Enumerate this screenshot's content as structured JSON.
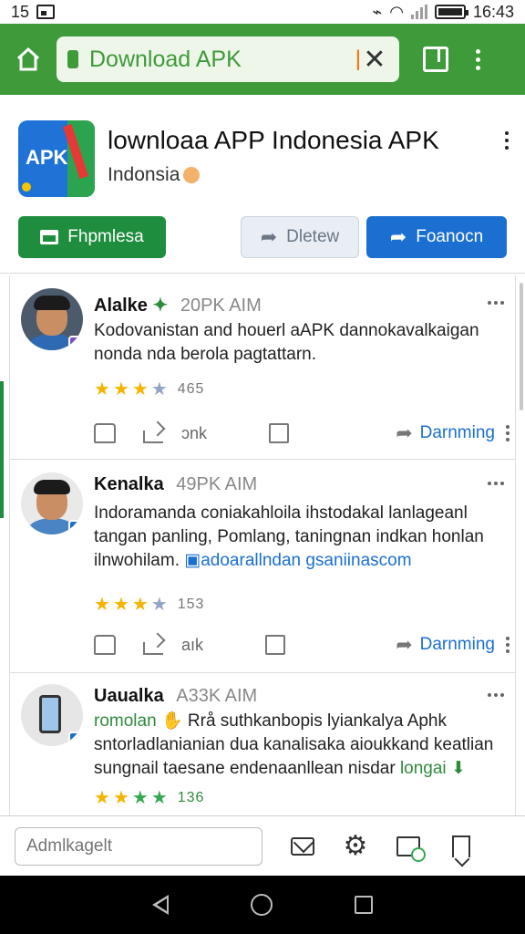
{
  "status_bar": {
    "time": "15",
    "clock": "16:43"
  },
  "browser": {
    "url_text": "Download APK",
    "clear_label": "✕"
  },
  "app": {
    "title": "lownloaa APP Indonesia APK",
    "subtitle": "Indonsia",
    "icon_text": "APK",
    "buttons": {
      "install": "Fhpmlesa",
      "detew": "Dletew",
      "foanoc": "Foanocn"
    }
  },
  "posts": [
    {
      "name": "Alalke",
      "meta": "20PK AIM",
      "lines": [
        "Kodovanistan and houerl aAPK dannokavalkaigan",
        "nonda nda berola pagtattarn."
      ],
      "stars_filled": 3,
      "stars_total": 4,
      "rating_count": "465",
      "action_text": "ɔnk",
      "action_label": "Darnming"
    },
    {
      "name": "Kenalka",
      "meta": "49PK AIM",
      "lines": [
        "Indoramanda coniakahloila ihstodakal lanlageanl",
        "tangan panling, Pomlang, taningnan indkan honlan",
        "ilnwohilam."
      ],
      "link": "adoarallndan gsaniinascom",
      "stars_filled": 3,
      "stars_total": 4,
      "rating_count": "153",
      "action_text": "aık",
      "action_label": "Darnming"
    },
    {
      "name": "Uaualka",
      "meta": "A33K AIM",
      "lead": "romolan",
      "lines": [
        "Rrå suthkanbopis lyiankalya Aphk",
        "sntorladlanianian dua kanalisaka aioukkand keatlian",
        "sungnail taesane endenaanllean nisdar"
      ],
      "tail": "longai",
      "stars_filled": 4,
      "stars_total": 4,
      "rating_count": "136"
    }
  ],
  "bottom_bar": {
    "comment_placeholder": "Admlkagelt"
  },
  "colors": {
    "brand_green": "#3f9a3a",
    "install_green": "#1e8e3e",
    "accent_blue": "#1a6fd1",
    "star_gold": "#f4b400"
  },
  "icons": [
    "home-icon",
    "lock-icon",
    "close-icon",
    "tabs-icon",
    "more-vert-icon",
    "share-icon",
    "thumb-up-icon",
    "forward-icon",
    "mail-icon",
    "settings-icon",
    "screenshot-icon",
    "bookmark-icon",
    "nav-back-icon",
    "nav-home-icon",
    "nav-recent-icon"
  ]
}
